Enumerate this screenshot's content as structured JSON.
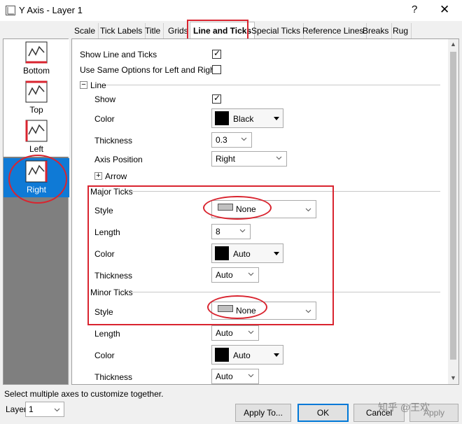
{
  "window": {
    "title": "Y Axis - Layer 1",
    "help_glyph": "?",
    "close_glyph": "✕"
  },
  "tabs": [
    "Scale",
    "Tick Labels",
    "Title",
    "Grids",
    "Line and Ticks",
    "Special Ticks",
    "Reference Lines",
    "Breaks",
    "Rug"
  ],
  "active_tab": "Line and Ticks",
  "axis_list": [
    {
      "label": "Bottom",
      "icon": "axis-bottom-icon",
      "selected": false
    },
    {
      "label": "Top",
      "icon": "axis-top-icon",
      "selected": false
    },
    {
      "label": "Left",
      "icon": "axis-left-icon",
      "selected": false
    },
    {
      "label": "Right",
      "icon": "axis-right-icon",
      "selected": true
    }
  ],
  "top_options": {
    "show_line_ticks": {
      "label": "Show Line and Ticks",
      "checked": true
    },
    "same_options": {
      "label": "Use Same Options for Left and Right",
      "checked": false
    }
  },
  "line": {
    "group_label": "Line",
    "show_label": "Show",
    "show_checked": true,
    "color_label": "Color",
    "color_value": "Black",
    "thickness_label": "Thickness",
    "thickness_value": "0.3",
    "position_label": "Axis Position",
    "position_value": "Right",
    "arrow_label": "Arrow"
  },
  "major_ticks": {
    "group_label": "Major Ticks",
    "style_label": "Style",
    "style_value": "None",
    "length_label": "Length",
    "length_value": "8",
    "color_label": "Color",
    "color_value": "Auto",
    "thickness_label": "Thickness",
    "thickness_value": "Auto"
  },
  "minor_ticks": {
    "group_label": "Minor Ticks",
    "style_label": "Style",
    "style_value": "None",
    "length_label": "Length",
    "length_value": "Auto",
    "color_label": "Color",
    "color_value": "Auto",
    "thickness_label": "Thickness",
    "thickness_value": "Auto"
  },
  "status_text": "Select multiple axes to customize together.",
  "layer": {
    "label": "Layer",
    "value": "1"
  },
  "buttons": {
    "apply_to": "Apply To...",
    "ok": "OK",
    "cancel": "Cancel",
    "apply": "Apply"
  },
  "watermark": "知乎 @王欢",
  "colors": {
    "selection": "#0f7ad6",
    "annotation": "#d9242f",
    "checkbox_tick": "#000000"
  }
}
